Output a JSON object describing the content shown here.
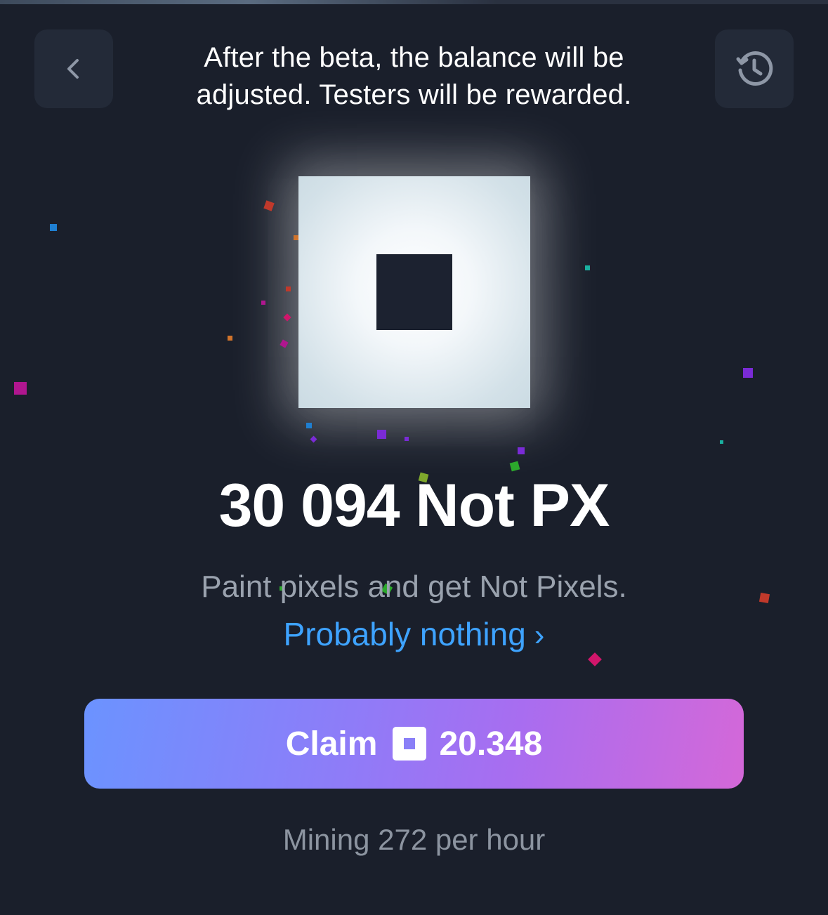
{
  "header": {
    "notice": "After the beta, the balance will be adjusted. Testers will be rewarded."
  },
  "balance": {
    "amount": "30 094",
    "unit": "Not PX"
  },
  "tagline": "Paint pixels and get Not Pixels.",
  "link": {
    "label": "Probably nothing",
    "chevron": "›"
  },
  "claim": {
    "label": "Claim",
    "amount": "20.348"
  },
  "mining": {
    "text": "Mining 272 per hour"
  },
  "icons": {
    "back": "chevron-left-icon",
    "history": "history-icon",
    "coin": "not-pixel-coin-icon"
  },
  "colors": {
    "background": "#1a1f2b",
    "button_bg": "#232a38",
    "link": "#3ea3ff",
    "claim_gradient_start": "#6b93ff",
    "claim_gradient_end": "#d468d8",
    "confetti": [
      "#c0392b",
      "#1f7fd1",
      "#b0168f",
      "#7a2bd6",
      "#2ca82c",
      "#7fa82c",
      "#d1166b",
      "#1ab0a0",
      "#d1732b"
    ]
  }
}
